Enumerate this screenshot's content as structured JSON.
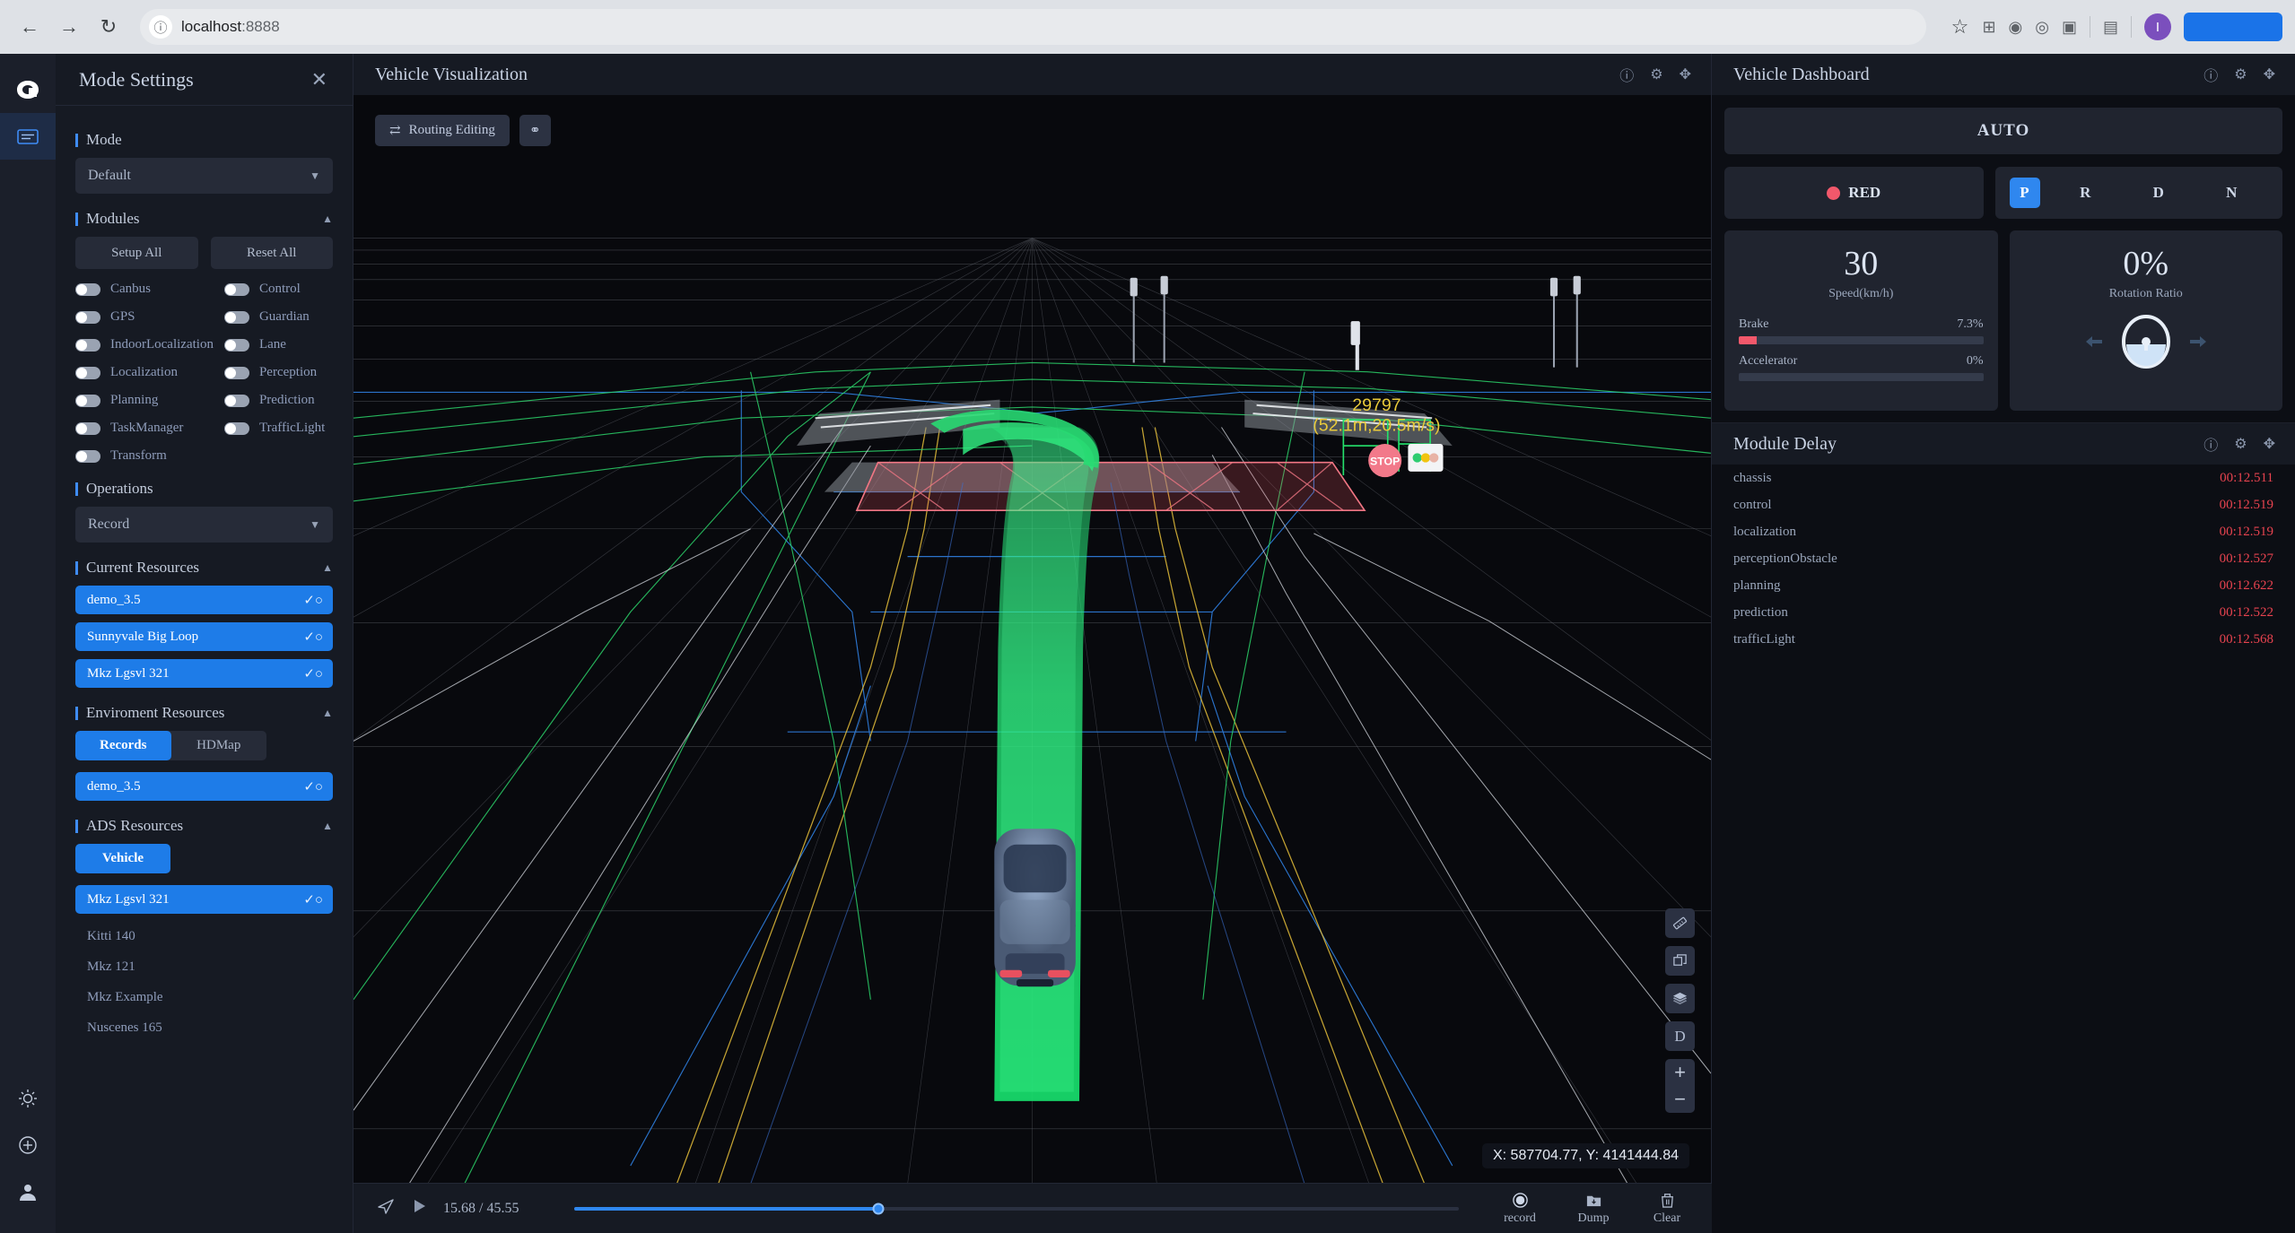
{
  "browser": {
    "url_host": "localhost",
    "url_port": ":8888",
    "back_icon": "back-arrow-icon",
    "forward_icon": "forward-arrow-icon",
    "reload_icon": "reload-icon",
    "info_icon": "info-circle-icon",
    "profile_initial": "I"
  },
  "rail": {
    "logo": "apollo-logo-icon",
    "items": [
      {
        "name": "mode-settings-icon",
        "active": true
      },
      {
        "name": "theme-icon",
        "active": false
      },
      {
        "name": "add-panel-icon",
        "active": false
      },
      {
        "name": "profile-icon",
        "active": false
      }
    ]
  },
  "mode_panel": {
    "title": "Mode Settings",
    "close_label": "✕",
    "sections": {
      "mode": {
        "label": "Mode",
        "value": "Default"
      },
      "modules": {
        "label": "Modules",
        "setup_all": "Setup All",
        "reset_all": "Reset All",
        "items": [
          {
            "label": "Canbus",
            "on": false
          },
          {
            "label": "Control",
            "on": false
          },
          {
            "label": "GPS",
            "on": false
          },
          {
            "label": "Guardian",
            "on": false
          },
          {
            "label": "IndoorLocalization",
            "on": false
          },
          {
            "label": "Lane",
            "on": false
          },
          {
            "label": "Localization",
            "on": false
          },
          {
            "label": "Perception",
            "on": false
          },
          {
            "label": "Planning",
            "on": false
          },
          {
            "label": "Prediction",
            "on": false
          },
          {
            "label": "TaskManager",
            "on": false
          },
          {
            "label": "TrafficLight",
            "on": false
          },
          {
            "label": "Transform",
            "on": false
          }
        ]
      },
      "operations": {
        "label": "Operations",
        "value": "Record"
      },
      "current_resources": {
        "label": "Current Resources",
        "items": [
          "demo_3.5",
          "Sunnyvale Big Loop",
          "Mkz Lgsvl 321"
        ]
      },
      "environment_resources": {
        "label": "Enviroment Resources",
        "tabs": [
          {
            "label": "Records",
            "on": true
          },
          {
            "label": "HDMap",
            "on": false
          }
        ],
        "selected": "demo_3.5"
      },
      "ads_resources": {
        "label": "ADS Resources",
        "tab": "Vehicle",
        "selected": "Mkz Lgsvl 321",
        "items": [
          "Kitti 140",
          "Mkz 121",
          "Mkz Example",
          "Nuscenes 165"
        ]
      }
    }
  },
  "viz": {
    "title": "Vehicle Visualization",
    "toolbar": [
      {
        "label": "Routing Editing",
        "icon": "routing-icon"
      },
      {
        "label": "",
        "icon": "route-settings-icon"
      }
    ],
    "header_icons": [
      "help-icon",
      "gear-icon",
      "expand-icon"
    ],
    "obstacle": {
      "id": "29797",
      "info": "(52.1m,20.5m/s)"
    },
    "coordinates": "X: 587704.77, Y: 4141444.84",
    "side_tools": [
      {
        "name": "ruler-icon",
        "glyph": "▱"
      },
      {
        "name": "copy-icon",
        "glyph": "❐"
      },
      {
        "name": "layers-icon",
        "glyph": "☰"
      },
      {
        "name": "direction-icon",
        "glyph": "D"
      }
    ],
    "zoom_in": "+",
    "zoom_out": "−"
  },
  "player": {
    "send_icon": "send-icon",
    "play_icon": "play-icon",
    "time": "15.68 / 45.55",
    "progress_pct": 34.4,
    "actions": [
      {
        "label": "record",
        "icon": "record-icon"
      },
      {
        "label": "Dump",
        "icon": "dump-icon"
      },
      {
        "label": "Clear",
        "icon": "trash-icon"
      }
    ]
  },
  "dashboard": {
    "title": "Vehicle Dashboard",
    "header_icons": [
      "help-icon",
      "gear-icon",
      "expand-icon"
    ],
    "auto_label": "AUTO",
    "signal": {
      "label": "RED",
      "color": "#f2586b"
    },
    "gears": [
      {
        "label": "P",
        "on": true
      },
      {
        "label": "R",
        "on": false
      },
      {
        "label": "D",
        "on": false
      },
      {
        "label": "N",
        "on": false
      }
    ],
    "speed": {
      "value": "30",
      "unit": "Speed(km/h)"
    },
    "brake": {
      "label": "Brake",
      "value": "7.3%",
      "pct": 7.3
    },
    "accelerator": {
      "label": "Accelerator",
      "value": "0%",
      "pct": 0
    },
    "rotation": {
      "value": "0%",
      "label": "Rotation Ratio",
      "left_icon": "arrow-left-icon",
      "right_icon": "arrow-right-icon",
      "wheel_icon": "steering-wheel-icon"
    }
  },
  "module_delay": {
    "title": "Module Delay",
    "header_icons": [
      "help-icon",
      "gear-icon",
      "expand-icon"
    ],
    "rows": [
      {
        "name": "chassis",
        "value": "00:12.511"
      },
      {
        "name": "control",
        "value": "00:12.519"
      },
      {
        "name": "localization",
        "value": "00:12.519"
      },
      {
        "name": "perceptionObstacle",
        "value": "00:12.527"
      },
      {
        "name": "planning",
        "value": "00:12.622"
      },
      {
        "name": "prediction",
        "value": "00:12.522"
      },
      {
        "name": "trafficLight",
        "value": "00:12.568"
      }
    ]
  },
  "colors": {
    "accent": "#1e7ce8",
    "danger": "#e8434f",
    "panel": "#161a23",
    "card": "#20242f"
  }
}
